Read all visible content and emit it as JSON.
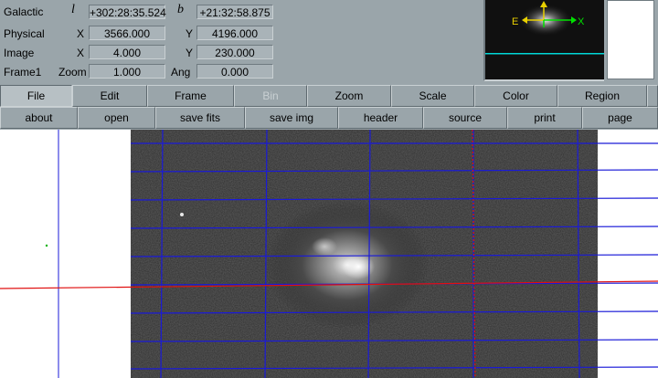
{
  "coords": {
    "galactic": {
      "label": "Galactic",
      "l_sym": "l",
      "l_val": "+302:28:35.524",
      "b_sym": "b",
      "b_val": "+21:32:58.875"
    },
    "physical": {
      "label": "Physical",
      "x_sym": "X",
      "x_val": "3566.000",
      "y_sym": "Y",
      "y_val": "4196.000"
    },
    "image": {
      "label": "Image",
      "x_sym": "X",
      "x_val": "4.000",
      "y_sym": "Y",
      "y_val": "230.000"
    },
    "frame": {
      "label": "Frame1",
      "zoom_label": "Zoom",
      "zoom_val": "1.000",
      "ang_label": "Ang",
      "ang_val": "0.000"
    }
  },
  "panner": {
    "east_label": "E",
    "x_label": "X"
  },
  "menubar": [
    {
      "label": "File",
      "state": "active"
    },
    {
      "label": "Edit",
      "state": "normal"
    },
    {
      "label": "Frame",
      "state": "normal"
    },
    {
      "label": "Bin",
      "state": "disabled"
    },
    {
      "label": "Zoom",
      "state": "normal"
    },
    {
      "label": "Scale",
      "state": "normal"
    },
    {
      "label": "Color",
      "state": "normal"
    },
    {
      "label": "Region",
      "state": "normal"
    }
  ],
  "buttonbar": [
    {
      "label": "about"
    },
    {
      "label": "open"
    },
    {
      "label": "save fits"
    },
    {
      "label": "save img"
    },
    {
      "label": "header"
    },
    {
      "label": "source"
    },
    {
      "label": "print"
    },
    {
      "label": "page"
    }
  ],
  "colors": {
    "grid": "#1a1ad8",
    "crosshair": "#e01010",
    "compass_north": "#e8d000",
    "compass_east": "#00e000",
    "panner_box": "#00d8d8"
  }
}
